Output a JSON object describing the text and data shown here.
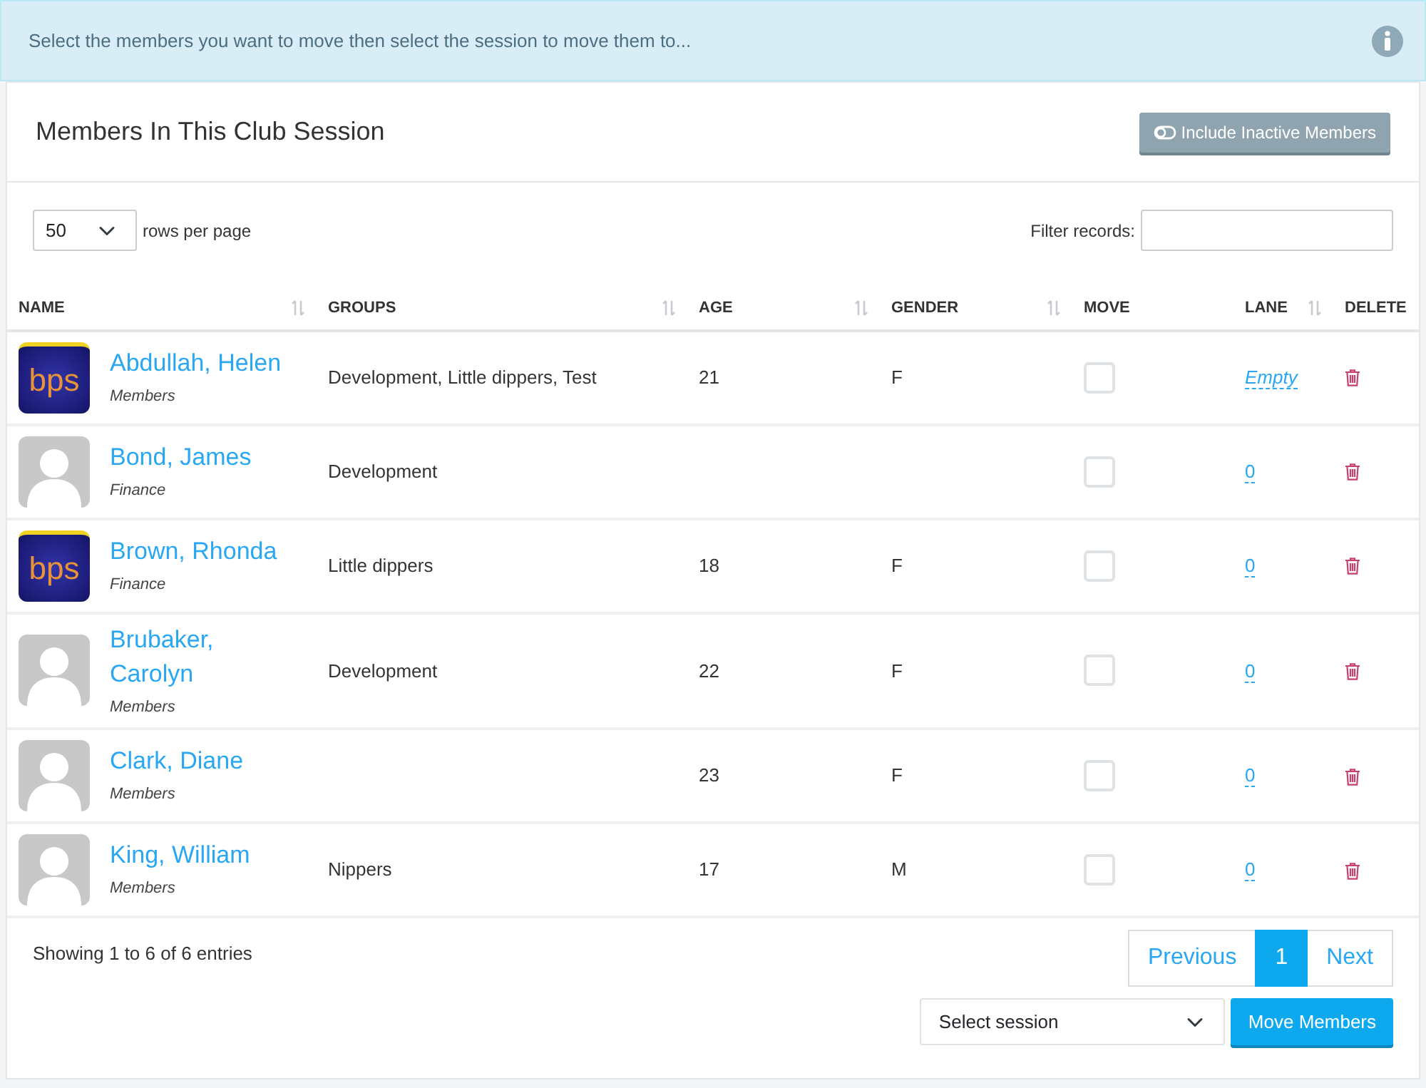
{
  "alert": {
    "text": "Select the members you want to move then select the session to move them to..."
  },
  "card": {
    "title": "Members In This Club Session",
    "toggle_button": {
      "label": "Include Inactive Members"
    }
  },
  "length": {
    "value": "50",
    "label": "rows per page"
  },
  "filter": {
    "label": "Filter records:"
  },
  "table": {
    "columns": [
      {
        "label": "NAME",
        "sortable": true
      },
      {
        "label": "GROUPS",
        "sortable": true
      },
      {
        "label": "AGE",
        "sortable": true
      },
      {
        "label": "GENDER",
        "sortable": true
      },
      {
        "label": "MOVE",
        "sortable": false
      },
      {
        "label": "LANE",
        "sortable": true
      },
      {
        "label": "DELETE",
        "sortable": false
      }
    ],
    "rows": [
      {
        "kind": "logo",
        "avatar_text": "bps",
        "name": "Abdullah, Helen",
        "role": "Members",
        "groups": "Development, Little dippers, Test",
        "age": "21",
        "gender": "F",
        "move": false,
        "lane": "Empty",
        "lane_empty": true
      },
      {
        "kind": "placeholder",
        "name": "Bond, James",
        "role": "Finance",
        "groups": "Development",
        "age": "",
        "gender": "",
        "move": false,
        "lane": "0",
        "lane_empty": false
      },
      {
        "kind": "logo",
        "avatar_text": "bps",
        "name": "Brown, Rhonda",
        "role": "Finance",
        "groups": "Little dippers",
        "age": "18",
        "gender": "F",
        "move": false,
        "lane": "0",
        "lane_empty": false
      },
      {
        "kind": "placeholder",
        "name": "Brubaker, Carolyn",
        "role": "Members",
        "groups": "Development",
        "age": "22",
        "gender": "F",
        "move": false,
        "lane": "0",
        "lane_empty": false
      },
      {
        "kind": "placeholder",
        "name": "Clark, Diane",
        "role": "Members",
        "groups": "",
        "age": "23",
        "gender": "F",
        "move": false,
        "lane": "0",
        "lane_empty": false
      },
      {
        "kind": "placeholder",
        "name": "King, William",
        "role": "Members",
        "groups": "Nippers",
        "age": "17",
        "gender": "M",
        "move": false,
        "lane": "0",
        "lane_empty": false
      }
    ]
  },
  "info": "Showing 1 to 6 of 6 entries",
  "pagination": [
    {
      "label": "Previous",
      "selected": false
    },
    {
      "label": "1",
      "selected": true
    },
    {
      "label": "Next",
      "selected": false
    }
  ],
  "session_select": {
    "value": "Select session"
  },
  "move_button": {
    "label": "Move Members"
  }
}
